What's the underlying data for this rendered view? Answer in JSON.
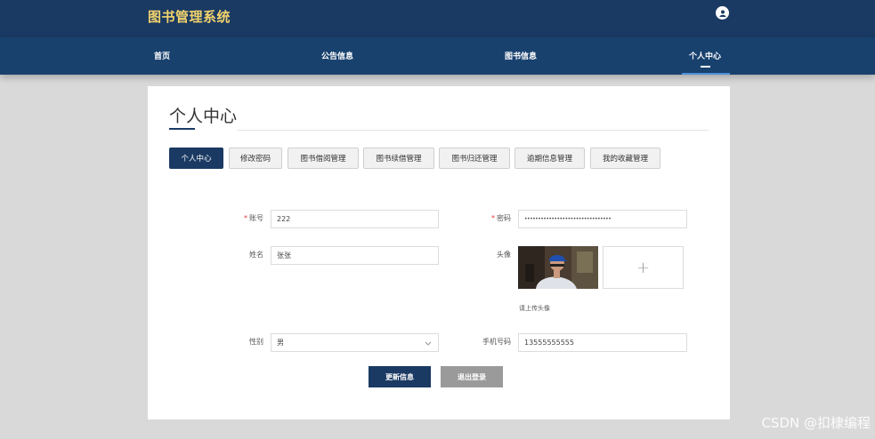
{
  "header": {
    "title": "图书管理系统"
  },
  "nav": {
    "items": [
      "首页",
      "公告信息",
      "图书信息",
      "个人中心"
    ]
  },
  "page": {
    "title": "个人中心"
  },
  "tabs": [
    "个人中心",
    "修改密码",
    "图书借阅管理",
    "图书续借管理",
    "图书归还管理",
    "逾期信息管理",
    "我的收藏管理"
  ],
  "form": {
    "account_label": "账号",
    "account_value": "222",
    "password_label": "密码",
    "password_value": "••••••••••••••••••••••••••••••••",
    "name_label": "姓名",
    "name_value": "张张",
    "avatar_label": "头像",
    "upload_hint": "请上传头像",
    "upload_plus": "+",
    "gender_label": "性别",
    "gender_value": "男",
    "phone_label": "手机号码",
    "phone_value": "13555555555"
  },
  "buttons": {
    "update": "更新信息",
    "logout": "退出登录"
  },
  "watermark": "CSDN @扣棣编程",
  "colors": {
    "header": "#1a3a63",
    "brand_title": "#f3d36c",
    "active_tab": "#1a3a63"
  }
}
